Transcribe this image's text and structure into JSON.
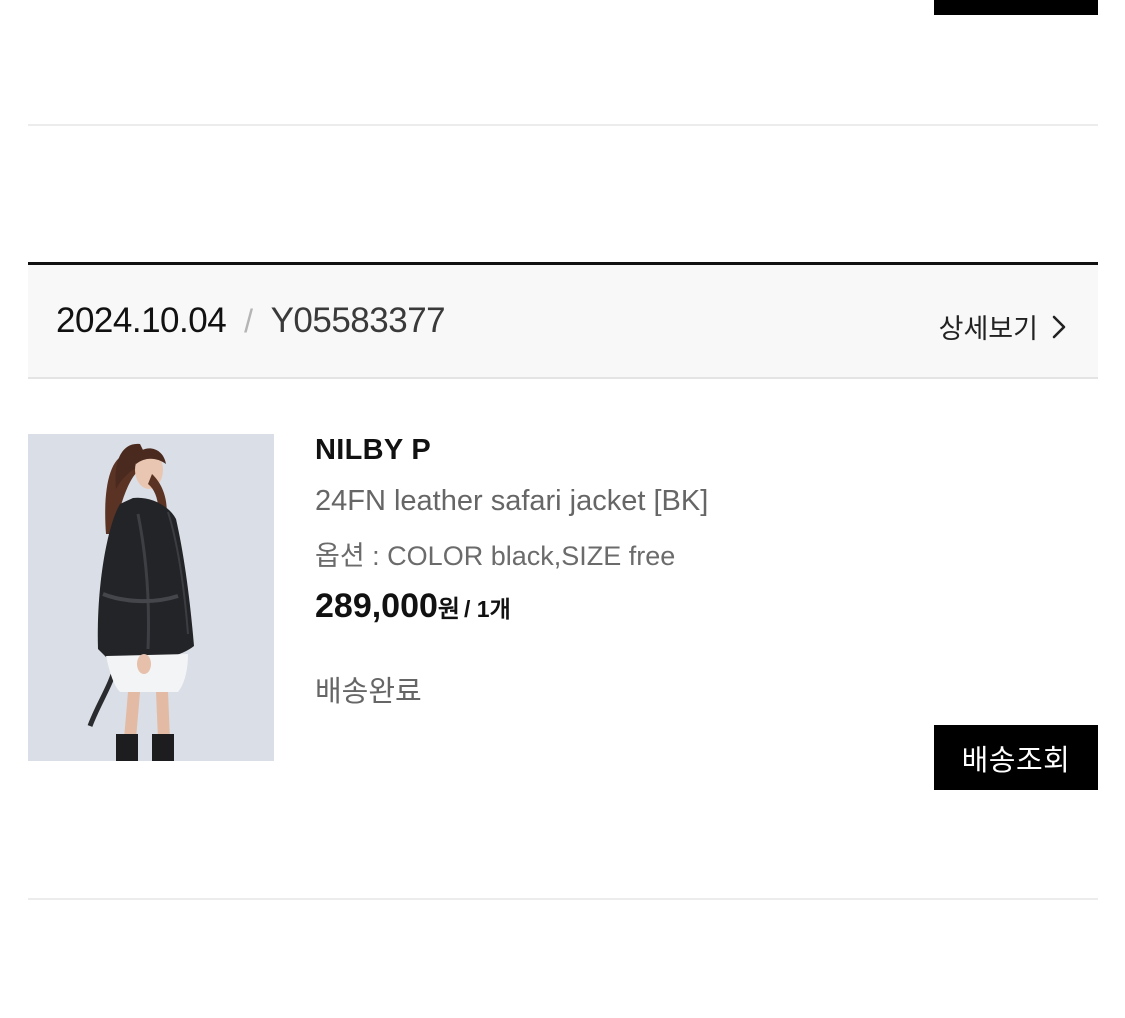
{
  "order": {
    "date": "2024.10.04",
    "separator": "/",
    "order_number": "Y05583377",
    "detail_label": "상세보기"
  },
  "product": {
    "brand": "NILBY P",
    "name": "24FN leather safari jacket [BK]",
    "option": "옵션 : COLOR black,SIZE free",
    "price": "289,000",
    "price_unit": "원",
    "quantity": "/ 1개",
    "status": "배송완료"
  },
  "actions": {
    "track_label": "배송조회"
  },
  "icons": {
    "detail_arrow": "chevron-right-icon"
  }
}
